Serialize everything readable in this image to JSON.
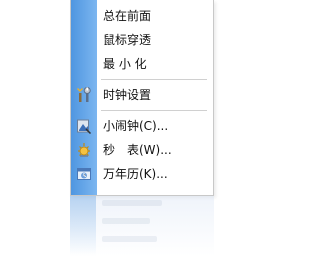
{
  "menu": {
    "items": [
      {
        "label": "总在前面",
        "icon": ""
      },
      {
        "label": "鼠标穿透",
        "icon": ""
      },
      {
        "label": "最 小 化",
        "icon": ""
      },
      {
        "separator": true
      },
      {
        "label": "时钟设置",
        "icon": "tools-icon"
      },
      {
        "separator": true
      },
      {
        "label": "小闹钟(C)...",
        "icon": "alarm-icon"
      },
      {
        "label": "秒　表(W)...",
        "icon": "stopwatch-icon"
      },
      {
        "label": "万年历(K)...",
        "icon": "calendar-icon"
      }
    ]
  },
  "colors": {
    "strip": "#4f96e0",
    "separator": "#d0d0d0",
    "text": "#111111"
  }
}
